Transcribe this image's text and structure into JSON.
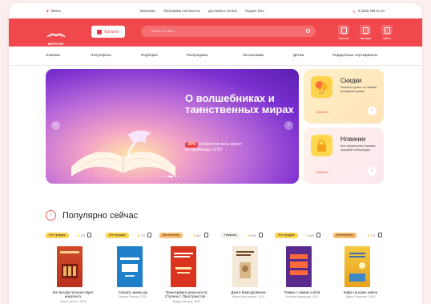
{
  "topbar": {
    "city": "Минск",
    "links": [
      "Магазины",
      "Программа лояльности",
      "Доставка и оплата",
      "Подпис Кэш"
    ],
    "phone": "8 (029) 359 91 24"
  },
  "header": {
    "logo_text": "МИРКНИГ",
    "catalog_label": "Каталог",
    "search_placeholder": "Поиск по сайту",
    "icons": [
      {
        "label": "Корзина",
        "icon": "cart-icon"
      },
      {
        "label": "Закладки",
        "icon": "bookmark-icon"
      },
      {
        "label": "Войти",
        "icon": "user-icon"
      }
    ]
  },
  "nav": [
    "Новинки",
    "Популярное",
    "Подборки",
    "Распродажа",
    "Эксклюзивы",
    "Детям",
    "Подарочные сертификаты"
  ],
  "banner": {
    "title": "О волшебниках и таинственных мирах",
    "discount": "-30%",
    "promo_line1": "на фэнтези весь август",
    "promo_line2": "по промокоду LETO"
  },
  "promos": [
    {
      "title": "Скидки",
      "desc": "Успейте купить по самым выгодным ценам",
      "link": "Перейти",
      "icon": "balloons-icon"
    },
    {
      "title": "Новинки",
      "desc": "Все актуальные новинки мировой литературы",
      "link": "Перейти",
      "icon": "lock-book-icon"
    }
  ],
  "section_title": "Популярно сейчас",
  "products": [
    {
      "badge": "Хит продаж",
      "rating": "7.8",
      "title": "Бог всегда путешествует инкогнито",
      "author": "Лоран Гунель, 2023"
    },
    {
      "badge": "Хит продаж",
      "rating": "7.5",
      "title": "Сказать жизни да",
      "author": "Виктор Франкл, 2011"
    },
    {
      "badge": "Бестселлер",
      "rating": "8.7",
      "title": "Трансерфинг реальности. Ступень I: Пространство...",
      "author": "Вадим Зеланд, 2023"
    },
    {
      "badge": "Новинка",
      "rating": "8.9",
      "title": "Дом в Мансуровском",
      "author": "Мария Метлицкая, 2024"
    },
    {
      "badge": "Хит продаж",
      "rating": "6.9",
      "title": "Роман с самим собой",
      "author": "Татьяна Мужицкая, 2021"
    },
    {
      "badge": "Бестселлер",
      "rating": "7.3",
      "title": "Кафе на краю земли",
      "author": "Джон Стрелеки, 2018"
    }
  ],
  "colors": {
    "brand_red": "#f0484d",
    "badge_hit": "#fbd34d",
    "badge_best": "#fbb96a",
    "badge_new": "#f1ede7"
  }
}
